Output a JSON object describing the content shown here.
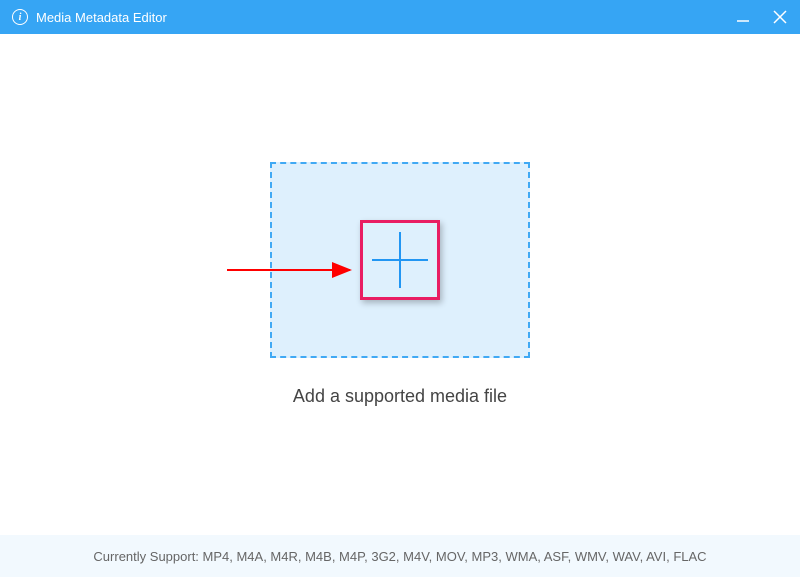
{
  "titlebar": {
    "title": "Media Metadata Editor"
  },
  "main": {
    "instruction": "Add a supported media file"
  },
  "footer": {
    "support_text": "Currently Support: MP4, M4A, M4R, M4B, M4P, 3G2, M4V, MOV, MP3, WMA, ASF, WMV, WAV, AVI, FLAC"
  }
}
